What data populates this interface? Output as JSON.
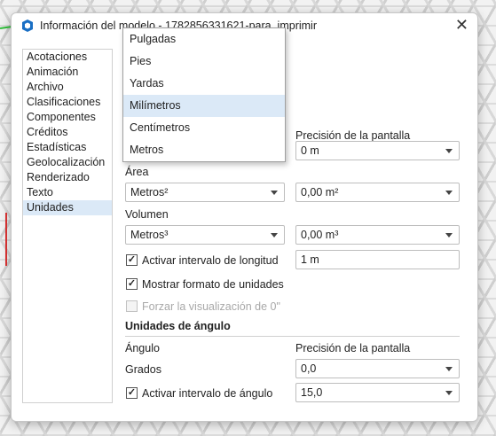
{
  "window": {
    "title": "Información del modelo - 1782856331621-para_imprimir",
    "close_glyph": "✕"
  },
  "sidebar": {
    "items": [
      {
        "label": "Acotaciones"
      },
      {
        "label": "Animación"
      },
      {
        "label": "Archivo"
      },
      {
        "label": "Clasificaciones"
      },
      {
        "label": "Componentes"
      },
      {
        "label": "Créditos"
      },
      {
        "label": "Estadísticas"
      },
      {
        "label": "Geolocalización"
      },
      {
        "label": "Renderizado"
      },
      {
        "label": "Texto"
      },
      {
        "label": "Unidades",
        "selected": true
      }
    ]
  },
  "length": {
    "display_precision_label": "Precisión de la pantalla",
    "length_precision_value": "0 m",
    "area_label": "Área",
    "area_unit": "Metros²",
    "area_precision": "0,00 m²",
    "volume_label": "Volumen",
    "volume_unit": "Metros³",
    "volume_precision": "0,00 m³",
    "length_snap_label": "Activar intervalo de longitud",
    "length_snap_checked": true,
    "length_snap_value": "1 m",
    "show_format_label": "Mostrar formato de unidades",
    "show_format_checked": true,
    "force_display_label": "Forzar la visualización de 0\"",
    "force_display_checked": false,
    "force_display_disabled": true
  },
  "angle": {
    "section_title": "Unidades de ángulo",
    "angle_label": "Ángulo",
    "display_precision_label": "Precisión de la pantalla",
    "degrees_label": "Grados",
    "precision_value": "0,0",
    "snap_label": "Activar intervalo de ángulo",
    "snap_checked": true,
    "snap_value": "15,0"
  },
  "unit_dropdown": {
    "options": [
      "Pulgadas",
      "Pies",
      "Yardas",
      "Milímetros",
      "Centímetros",
      "Metros"
    ],
    "highlighted": "Milímetros"
  },
  "colors": {
    "accent": "#dbe9f7",
    "brand_icon": "#1a6fc4"
  },
  "icons": {
    "app": "sketchup-icon",
    "close": "close-icon",
    "dropdown_arrow": "chevron-down-icon",
    "check": "check-icon"
  }
}
